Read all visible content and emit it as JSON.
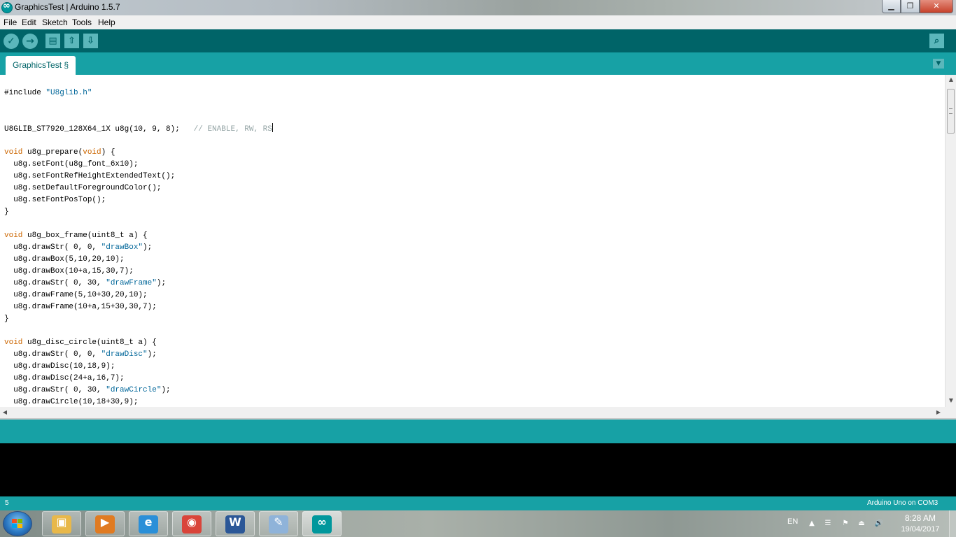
{
  "window": {
    "title": "GraphicsTest | Arduino 1.5.7",
    "minimize_glyph": "▁",
    "maximize_glyph": "❐",
    "close_glyph": "✕"
  },
  "menu": {
    "items": [
      "File",
      "Edit",
      "Sketch",
      "Tools",
      "Help"
    ]
  },
  "toolbar": {
    "verify_glyph": "✓",
    "upload_glyph": "→",
    "new_glyph": "▤",
    "open_glyph": "⇧",
    "save_glyph": "⇩",
    "serial_monitor_glyph": "⌕"
  },
  "tabs": {
    "active": "GraphicsTest §",
    "menu_glyph": "▼"
  },
  "editor": {
    "lines": [
      [
        {
          "t": "#include "
        },
        {
          "t": "\"U8glib.h\"",
          "c": "str"
        }
      ],
      [],
      [],
      [
        {
          "t": "U8GLIB_ST7920_128X64_1X u8g(10, 9, 8);   "
        },
        {
          "t": "// ENABLE, RW, RS",
          "c": "cmt"
        },
        {
          "caret": true
        }
      ],
      [],
      [
        {
          "t": "void",
          "c": "kw"
        },
        {
          "t": " u8g_prepare("
        },
        {
          "t": "void",
          "c": "kw"
        },
        {
          "t": ") {"
        }
      ],
      [
        {
          "t": "  u8g.setFont(u8g_font_6x10);"
        }
      ],
      [
        {
          "t": "  u8g.setFontRefHeightExtendedText();"
        }
      ],
      [
        {
          "t": "  u8g.setDefaultForegroundColor();"
        }
      ],
      [
        {
          "t": "  u8g.setFontPosTop();"
        }
      ],
      [
        {
          "t": "}"
        }
      ],
      [],
      [
        {
          "t": "void",
          "c": "kw"
        },
        {
          "t": " u8g_box_frame(uint8_t a) {"
        }
      ],
      [
        {
          "t": "  u8g.drawStr( 0, 0, "
        },
        {
          "t": "\"drawBox\"",
          "c": "str"
        },
        {
          "t": ");"
        }
      ],
      [
        {
          "t": "  u8g.drawBox(5,10,20,10);"
        }
      ],
      [
        {
          "t": "  u8g.drawBox(10+a,15,30,7);"
        }
      ],
      [
        {
          "t": "  u8g.drawStr( 0, 30, "
        },
        {
          "t": "\"drawFrame\"",
          "c": "str"
        },
        {
          "t": ");"
        }
      ],
      [
        {
          "t": "  u8g.drawFrame(5,10+30,20,10);"
        }
      ],
      [
        {
          "t": "  u8g.drawFrame(10+a,15+30,30,7);"
        }
      ],
      [
        {
          "t": "}"
        }
      ],
      [],
      [
        {
          "t": "void",
          "c": "kw"
        },
        {
          "t": " u8g_disc_circle(uint8_t a) {"
        }
      ],
      [
        {
          "t": "  u8g.drawStr( 0, 0, "
        },
        {
          "t": "\"drawDisc\"",
          "c": "str"
        },
        {
          "t": ");"
        }
      ],
      [
        {
          "t": "  u8g.drawDisc(10,18,9);"
        }
      ],
      [
        {
          "t": "  u8g.drawDisc(24+a,16,7);"
        }
      ],
      [
        {
          "t": "  u8g.drawStr( 0, 30, "
        },
        {
          "t": "\"drawCircle\"",
          "c": "str"
        },
        {
          "t": ");"
        }
      ],
      [
        {
          "t": "  u8g.drawCircle(10,18+30,9);"
        }
      ]
    ],
    "colors": {
      "keyword": "#cc6600",
      "string": "#006699",
      "comment": "#95a5a6"
    },
    "scroll_up_glyph": "▲",
    "scroll_down_glyph": "▼",
    "scroll_left_glyph": "◀",
    "scroll_right_glyph": "▶"
  },
  "status": {
    "line_number": "5",
    "board": "Arduino Uno on COM3"
  },
  "taskbar": {
    "apps": [
      {
        "name": "file-explorer-icon",
        "glyph": "▣",
        "color": "#e8b84a"
      },
      {
        "name": "media-player-icon",
        "glyph": "▶",
        "color": "#e07b22"
      },
      {
        "name": "internet-explorer-icon",
        "glyph": "e",
        "color": "#2a8fd8"
      },
      {
        "name": "chrome-icon",
        "glyph": "◉",
        "color": "#d9443a"
      },
      {
        "name": "word-icon",
        "glyph": "W",
        "color": "#2b5797"
      },
      {
        "name": "paint-icon",
        "glyph": "✎",
        "color": "#8fb3d9"
      },
      {
        "name": "arduino-icon",
        "glyph": "∞",
        "color": "#00979c"
      }
    ],
    "language": "EN",
    "tray_icons": [
      {
        "name": "show-hidden-icons-icon",
        "glyph": "▲"
      },
      {
        "name": "tray-app-icon",
        "glyph": "☰"
      },
      {
        "name": "action-center-flag-icon",
        "glyph": "⚑"
      },
      {
        "name": "safely-remove-hardware-icon",
        "glyph": "⏏"
      },
      {
        "name": "volume-icon",
        "glyph": "🔊"
      }
    ],
    "time": "8:28 AM",
    "date": "19/04/2017"
  }
}
